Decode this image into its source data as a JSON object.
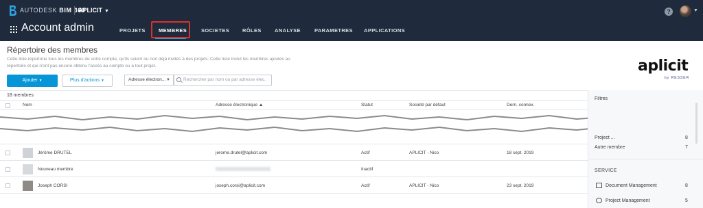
{
  "topbar": {
    "brand_prefix": "AUTODESK",
    "brand_product": "BIM 360",
    "account": "APLICIT"
  },
  "nav": {
    "app_title": "Account admin",
    "tabs": [
      "PROJETS",
      "MEMBRES",
      "SOCIETES",
      "RÔLES",
      "ANALYSE",
      "PARAMETRES",
      "APPLICATIONS"
    ],
    "active_tab": "MEMBRES"
  },
  "header": {
    "title": "Répertoire des membres",
    "description": "Cette liste répertorie tous les membres de votre compte, qu'ils soient ou non déjà invités à des projets. Cette liste inclut les membres ajoutés au répertoire et qui n'ont pas encore obtenu l'accès au compte ou à tout projet."
  },
  "toolbar": {
    "add_label": "Ajouter",
    "more_label": "Plus d'actions",
    "filter_value": "Adresse électron...",
    "search_placeholder": "Rechercher par nom ou par adresse élec."
  },
  "logo": {
    "word": "aplicit",
    "sub": "by RESSER"
  },
  "table": {
    "count": "18 membres",
    "columns": [
      "Nom",
      "Adresse électronique ▲",
      "Statut",
      "Société par défaut",
      "Dern. connex."
    ],
    "rows": [
      {
        "name": "Jérôme DRUTEL",
        "email": "jerome.drutel@aplicit.com",
        "status": "Actif",
        "company": "APLICIT - Nico",
        "last": "18 sept. 2019"
      },
      {
        "name": "Nouveau membre",
        "email": "",
        "status": "Inactif",
        "company": "",
        "last": ""
      },
      {
        "name": "Joseph CORSI",
        "email": "joseph.corsi@aplicit.com",
        "status": "Actif",
        "company": "APLICIT - Nico",
        "last": "23 sept. 2019"
      }
    ]
  },
  "filters": {
    "title": "Filtres",
    "items": [
      {
        "label": "Project ...",
        "count": "8"
      },
      {
        "label": "Autre membre",
        "count": "7"
      }
    ],
    "service_heading": "SERVICE",
    "services": [
      {
        "label": "Document Management",
        "count": "8"
      },
      {
        "label": "Project Management",
        "count": "5"
      }
    ]
  },
  "colors": {
    "topbar": "#1f2b3c",
    "accent": "#0696d7",
    "highlight": "#d8332a"
  }
}
